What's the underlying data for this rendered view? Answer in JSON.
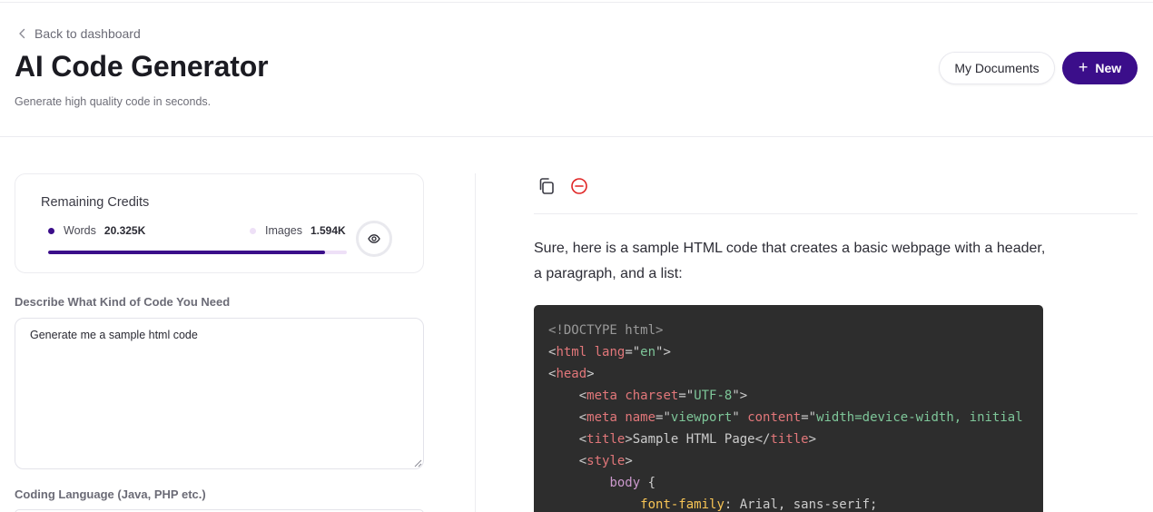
{
  "header": {
    "back_label": "Back to dashboard",
    "title": "AI Code Generator",
    "subtitle": "Generate high quality code in seconds.",
    "my_documents_label": "My Documents",
    "new_label": "New"
  },
  "credits": {
    "title": "Remaining Credits",
    "words_label": "Words",
    "words_value": "20.325K",
    "images_label": "Images",
    "images_value": "1.594K",
    "words_bar_fraction": 0.927,
    "colors": {
      "words": "#3b0e8a",
      "images": "#eee0f7"
    }
  },
  "form": {
    "description_label": "Describe What Kind of Code You Need",
    "description_value": "Generate me a sample html code",
    "language_label": "Coding Language (Java, PHP etc.)"
  },
  "output": {
    "toolbar": {
      "copy_icon": "copy-icon",
      "delete_icon": "minus-circle-icon"
    },
    "intro_text": "Sure, here is a sample HTML code that creates a basic webpage with a header, a paragraph, and a list:",
    "code_lines": [
      [
        [
          "doc",
          "<!DOCTYPE html>"
        ]
      ],
      [
        [
          "plain",
          "<"
        ],
        [
          "tag",
          "html"
        ],
        [
          "plain",
          " "
        ],
        [
          "attr",
          "lang"
        ],
        [
          "plain",
          "=\""
        ],
        [
          "str",
          "en"
        ],
        [
          "plain",
          "\">"
        ]
      ],
      [
        [
          "plain",
          "<"
        ],
        [
          "tag",
          "head"
        ],
        [
          "plain",
          ">"
        ]
      ],
      [
        [
          "plain",
          "    <"
        ],
        [
          "tag",
          "meta"
        ],
        [
          "plain",
          " "
        ],
        [
          "attr",
          "charset"
        ],
        [
          "plain",
          "=\""
        ],
        [
          "str",
          "UTF-8"
        ],
        [
          "plain",
          "\">"
        ]
      ],
      [
        [
          "plain",
          "    <"
        ],
        [
          "tag",
          "meta"
        ],
        [
          "plain",
          " "
        ],
        [
          "attr",
          "name"
        ],
        [
          "plain",
          "=\""
        ],
        [
          "str",
          "viewport"
        ],
        [
          "plain",
          "\" "
        ],
        [
          "attr",
          "content"
        ],
        [
          "plain",
          "=\""
        ],
        [
          "str",
          "width=device-width, initial"
        ]
      ],
      [
        [
          "plain",
          "    <"
        ],
        [
          "tag",
          "title"
        ],
        [
          "plain",
          ">Sample HTML Page</"
        ],
        [
          "tag",
          "title"
        ],
        [
          "plain",
          ">"
        ]
      ],
      [
        [
          "plain",
          "    <"
        ],
        [
          "tag",
          "style"
        ],
        [
          "plain",
          ">"
        ]
      ],
      [
        [
          "plain",
          "        "
        ],
        [
          "sel",
          "body"
        ],
        [
          "plain",
          " {"
        ]
      ],
      [
        [
          "plain",
          "            "
        ],
        [
          "prop",
          "font-family"
        ],
        [
          "plain",
          ": Arial, sans-serif;"
        ]
      ]
    ]
  }
}
